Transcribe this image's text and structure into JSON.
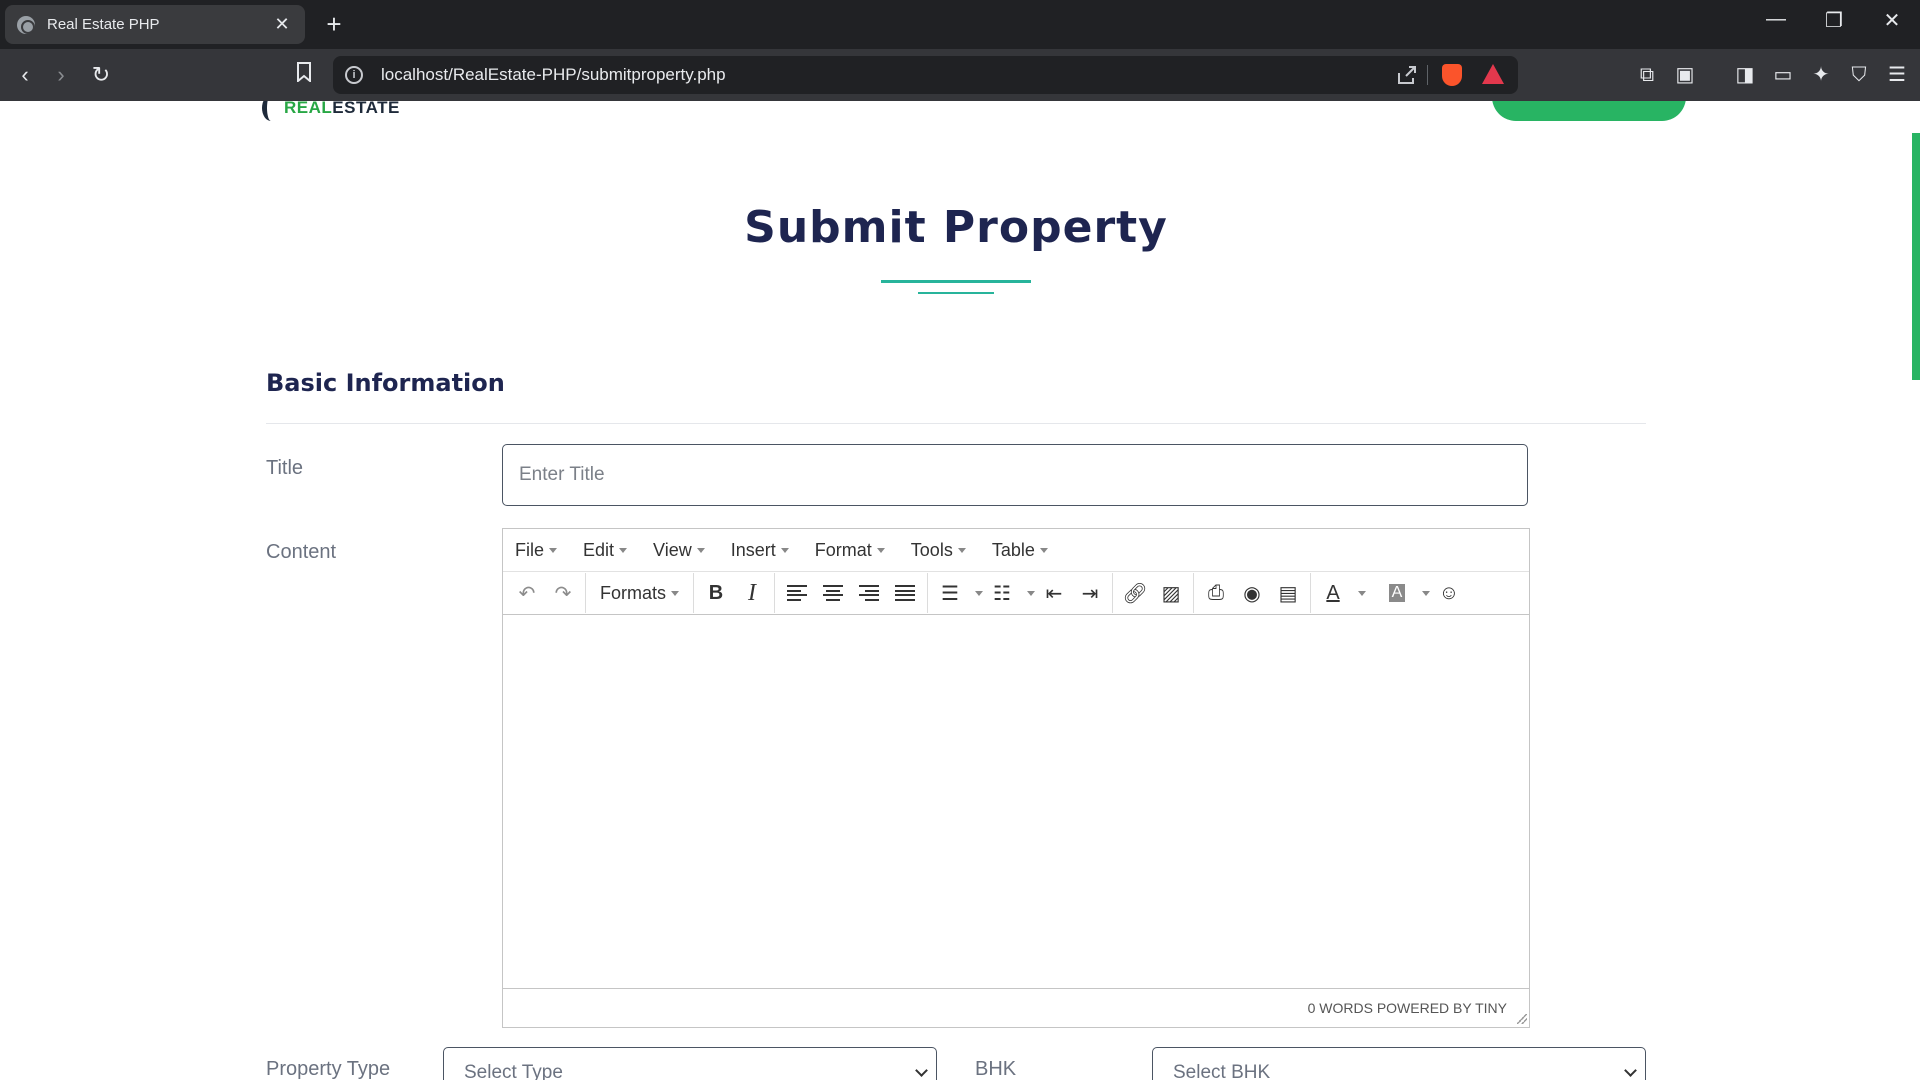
{
  "browser": {
    "tab_title": "Real Estate PHP",
    "url": "localhost/RealEstate-PHP/submitproperty.php"
  },
  "site": {
    "logo_real": "REAL",
    "logo_estate": "ESTATE"
  },
  "page": {
    "title": "Submit Property",
    "section_heading": "Basic Information"
  },
  "form": {
    "title_label": "Title",
    "title_placeholder": "Enter Title",
    "content_label": "Content",
    "property_type_label": "Property Type",
    "property_type_placeholder": "Select Type",
    "bhk_label": "BHK",
    "bhk_placeholder": "Select BHK"
  },
  "editor": {
    "menus": [
      "File",
      "Edit",
      "View",
      "Insert",
      "Format",
      "Tools",
      "Table"
    ],
    "formats_label": "Formats",
    "bold_glyph": "B",
    "italic_glyph": "I",
    "statusbar": "0 WORDS POWERED BY TINY"
  },
  "colors": {
    "accent_green": "#28b463",
    "title_navy": "#1e2550",
    "underline_teal": "#28b49b"
  }
}
